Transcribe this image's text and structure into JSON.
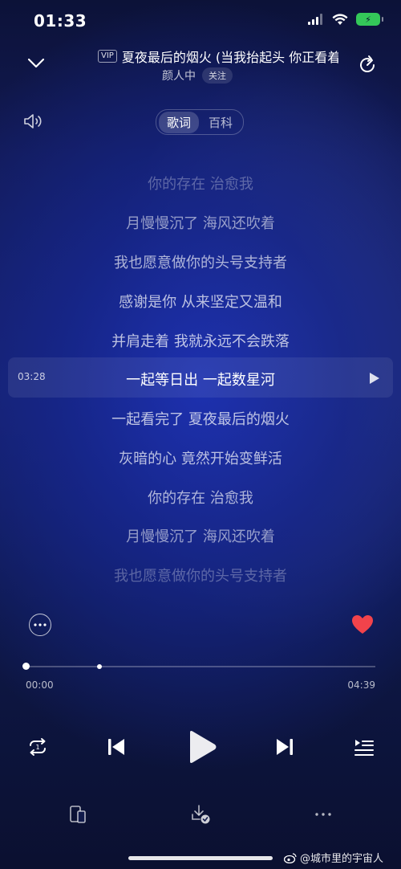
{
  "status_bar": {
    "time": "01:33",
    "battery": "⚡"
  },
  "header": {
    "vip_badge": "VIP",
    "song_title": "夏夜最后的烟火 (当我抬起头 你正看着我)",
    "artist": "颜人中",
    "follow_label": "关注"
  },
  "tabs": [
    {
      "label": "歌词",
      "active": true
    },
    {
      "label": "百科",
      "active": false
    }
  ],
  "lyrics": [
    {
      "text": "你的存在 治愈我",
      "opacity": 0.3
    },
    {
      "text": "月慢慢沉了 海风还吹着",
      "opacity": 0.55
    },
    {
      "text": "我也愿意做你的头号支持者",
      "opacity": 0.65
    },
    {
      "text": "感谢是你 从来坚定又温和",
      "opacity": 0.7
    },
    {
      "text": "并肩走着 我就永远不会跌落",
      "opacity": 0.72
    },
    {
      "text": "一起等日出 一起数星河",
      "opacity": 1.0
    },
    {
      "text": "一起看完了 夏夜最后的烟火",
      "opacity": 0.72
    },
    {
      "text": "灰暗的心 竟然开始变鲜活",
      "opacity": 0.7
    },
    {
      "text": "你的存在 治愈我",
      "opacity": 0.65
    },
    {
      "text": "月慢慢沉了 海风还吹着",
      "opacity": 0.55
    },
    {
      "text": "我也愿意做你的头号支持者",
      "opacity": 0.3
    }
  ],
  "current_line_time": "03:28",
  "playback": {
    "elapsed": "00:00",
    "duration": "04:39",
    "progress_fraction": 0.0,
    "buffered_fraction": 0.21
  },
  "colors": {
    "like_red": "#f2434b",
    "accent_blue": "#1a2a9a"
  },
  "icons": {
    "collapse": "chevron-down-icon",
    "share": "share-icon",
    "volume": "volume-icon",
    "more_comments": "comment-dots-icon",
    "like": "heart-icon",
    "repeat": "repeat-one-icon",
    "prev": "skip-previous-icon",
    "play": "play-icon",
    "next": "skip-next-icon",
    "playlist": "playlist-icon"
  },
  "watermark": "@城市里的宇宙人"
}
